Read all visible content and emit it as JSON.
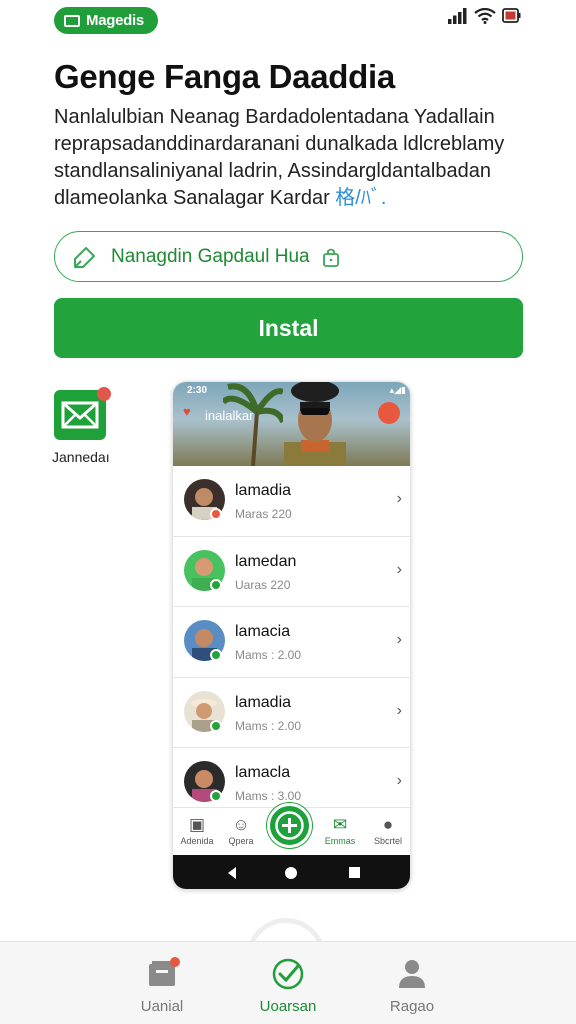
{
  "status_bar": {
    "app_badge": "Magedis"
  },
  "header": {
    "title": "Genge Fanga Daaddia",
    "description": "Nanlalulbian Neanag Bardadolentadana Yadallain reprapsadanddinardaranani dunalkada ldlcreblamy standlansaliniyanal ladrin, Assindargldantalbadan dlameolanka Sanalagar Kardar",
    "description_accent": "格/ﾊﾞ."
  },
  "actions": {
    "outline_label": "Nanagdin Gapdaul Hua",
    "install_label": "Instal"
  },
  "side_app": {
    "label": "Jannedaı"
  },
  "phone": {
    "time": "2:30",
    "hero_label": "inalalkar",
    "rows": [
      {
        "name": "lamadia",
        "sub": "Maras 220",
        "badge_color": "#e8583f"
      },
      {
        "name": "lamedan",
        "sub": "Uaras 220",
        "badge_color": "#22a33c"
      },
      {
        "name": "lamacia",
        "sub": "Mams : 2.00",
        "badge_color": "#22a33c"
      },
      {
        "name": "lamadia",
        "sub": "Mams : 2.00",
        "badge_color": "#22a33c"
      },
      {
        "name": "lamacla",
        "sub": "Mams : 3.00",
        "badge_color": "#22a33c"
      }
    ],
    "nav": [
      {
        "label": "Adenida"
      },
      {
        "label": "Qpera"
      },
      {
        "label": "Emmas"
      },
      {
        "label": "Sbcrtel"
      }
    ]
  },
  "bottom_nav": [
    {
      "label": "Uanial"
    },
    {
      "label": "Uoarsan"
    },
    {
      "label": "Ragao"
    }
  ],
  "colors": {
    "accent": "#22a33c",
    "link": "#2a8fd6",
    "alert": "#e8583f"
  }
}
